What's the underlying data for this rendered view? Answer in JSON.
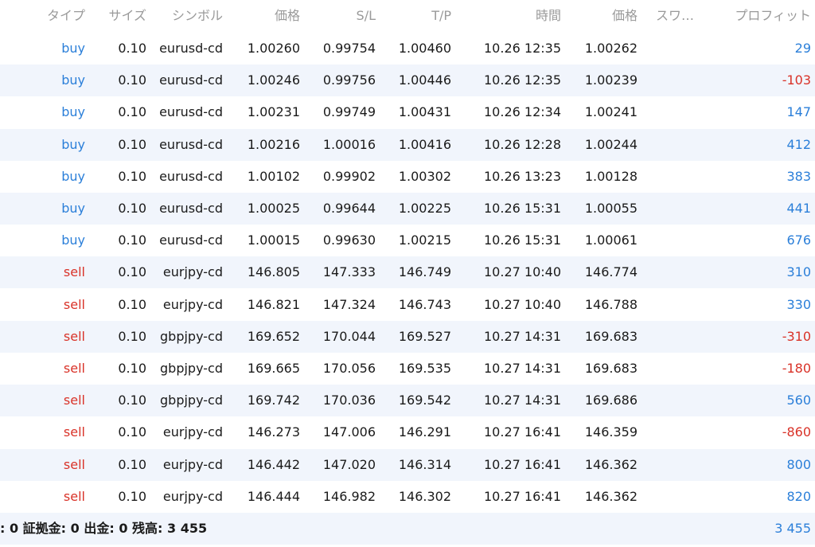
{
  "header": {
    "type": "タイプ",
    "size": "サイズ",
    "symbol": "シンボル",
    "price": "価格",
    "sl": "S/L",
    "tp": "T/P",
    "time": "時間",
    "price2": "価格",
    "swap": "スワ…",
    "profit": "プロフィット"
  },
  "rows": [
    {
      "type": "buy",
      "size": "0.10",
      "symbol": "eurusd-cd",
      "price": "1.00260",
      "sl": "0.99754",
      "tp": "1.00460",
      "time": "10.26 12:35",
      "price2": "1.00262",
      "profit": "29"
    },
    {
      "type": "buy",
      "size": "0.10",
      "symbol": "eurusd-cd",
      "price": "1.00246",
      "sl": "0.99756",
      "tp": "1.00446",
      "time": "10.26 12:35",
      "price2": "1.00239",
      "profit": "-103"
    },
    {
      "type": "buy",
      "size": "0.10",
      "symbol": "eurusd-cd",
      "price": "1.00231",
      "sl": "0.99749",
      "tp": "1.00431",
      "time": "10.26 12:34",
      "price2": "1.00241",
      "profit": "147"
    },
    {
      "type": "buy",
      "size": "0.10",
      "symbol": "eurusd-cd",
      "price": "1.00216",
      "sl": "1.00016",
      "tp": "1.00416",
      "time": "10.26 12:28",
      "price2": "1.00244",
      "profit": "412"
    },
    {
      "type": "buy",
      "size": "0.10",
      "symbol": "eurusd-cd",
      "price": "1.00102",
      "sl": "0.99902",
      "tp": "1.00302",
      "time": "10.26 13:23",
      "price2": "1.00128",
      "profit": "383"
    },
    {
      "type": "buy",
      "size": "0.10",
      "symbol": "eurusd-cd",
      "price": "1.00025",
      "sl": "0.99644",
      "tp": "1.00225",
      "time": "10.26 15:31",
      "price2": "1.00055",
      "profit": "441"
    },
    {
      "type": "buy",
      "size": "0.10",
      "symbol": "eurusd-cd",
      "price": "1.00015",
      "sl": "0.99630",
      "tp": "1.00215",
      "time": "10.26 15:31",
      "price2": "1.00061",
      "profit": "676"
    },
    {
      "type": "sell",
      "size": "0.10",
      "symbol": "eurjpy-cd",
      "price": "146.805",
      "sl": "147.333",
      "tp": "146.749",
      "time": "10.27 10:40",
      "price2": "146.774",
      "profit": "310"
    },
    {
      "type": "sell",
      "size": "0.10",
      "symbol": "eurjpy-cd",
      "price": "146.821",
      "sl": "147.324",
      "tp": "146.743",
      "time": "10.27 10:40",
      "price2": "146.788",
      "profit": "330"
    },
    {
      "type": "sell",
      "size": "0.10",
      "symbol": "gbpjpy-cd",
      "price": "169.652",
      "sl": "170.044",
      "tp": "169.527",
      "time": "10.27 14:31",
      "price2": "169.683",
      "profit": "-310"
    },
    {
      "type": "sell",
      "size": "0.10",
      "symbol": "gbpjpy-cd",
      "price": "169.665",
      "sl": "170.056",
      "tp": "169.535",
      "time": "10.27 14:31",
      "price2": "169.683",
      "profit": "-180"
    },
    {
      "type": "sell",
      "size": "0.10",
      "symbol": "gbpjpy-cd",
      "price": "169.742",
      "sl": "170.036",
      "tp": "169.542",
      "time": "10.27 14:31",
      "price2": "169.686",
      "profit": "560"
    },
    {
      "type": "sell",
      "size": "0.10",
      "symbol": "eurjpy-cd",
      "price": "146.273",
      "sl": "147.006",
      "tp": "146.291",
      "time": "10.27 16:41",
      "price2": "146.359",
      "profit": "-860"
    },
    {
      "type": "sell",
      "size": "0.10",
      "symbol": "eurjpy-cd",
      "price": "146.442",
      "sl": "147.020",
      "tp": "146.314",
      "time": "10.27 16:41",
      "price2": "146.362",
      "profit": "800"
    },
    {
      "type": "sell",
      "size": "0.10",
      "symbol": "eurjpy-cd",
      "price": "146.444",
      "sl": "146.982",
      "tp": "146.302",
      "time": "10.27 16:41",
      "price2": "146.362",
      "profit": "820"
    }
  ],
  "footer": {
    "summary": ": 0 証拠金: 0 出金: 0 残高: 3 455",
    "total": "3 455"
  },
  "colors": {
    "buy": "#2b7fd9",
    "sell": "#d93228",
    "profit_positive": "#2b7fd9",
    "profit_negative": "#d93228",
    "header_text": "#9a9a9a",
    "alt_row_bg": "#f1f5fc"
  }
}
